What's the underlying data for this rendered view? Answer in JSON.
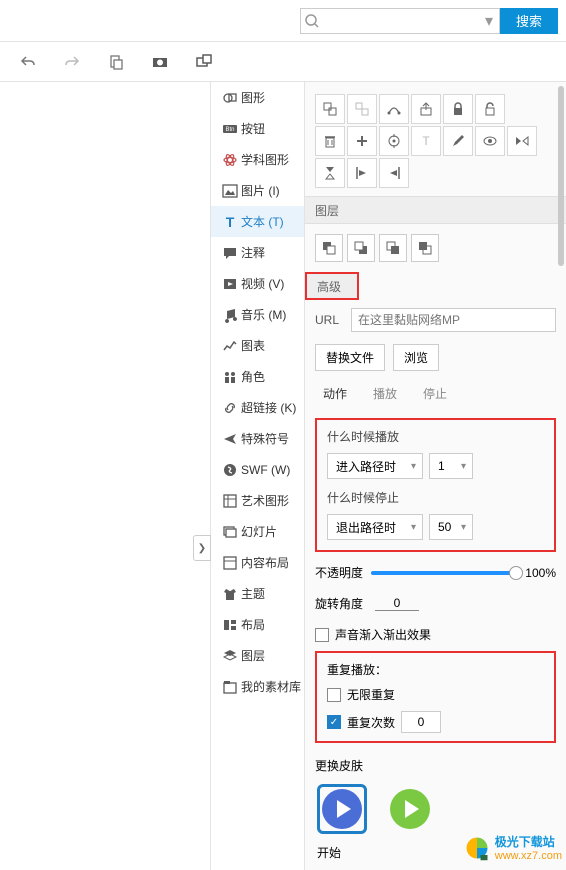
{
  "search": {
    "placeholder": "",
    "button": "搜索"
  },
  "sidebar": {
    "items": [
      {
        "label": "图形"
      },
      {
        "label": "按钮"
      },
      {
        "label": "学科图形"
      },
      {
        "label": "图片 (I)"
      },
      {
        "label": "文本 (T)"
      },
      {
        "label": "注释"
      },
      {
        "label": "视频 (V)"
      },
      {
        "label": "音乐 (M)"
      },
      {
        "label": "图表"
      },
      {
        "label": "角色"
      },
      {
        "label": "超链接 (K)"
      },
      {
        "label": "特殊符号"
      },
      {
        "label": "SWF (W)"
      },
      {
        "label": "艺术图形"
      },
      {
        "label": "幻灯片"
      },
      {
        "label": "内容布局"
      },
      {
        "label": "主题"
      },
      {
        "label": "布局"
      },
      {
        "label": "图层"
      },
      {
        "label": "我的素材库"
      }
    ]
  },
  "panel": {
    "layer_title": "图层",
    "advanced_title": "高级",
    "url_label": "URL",
    "url_placeholder": "在这里黏贴网络MP",
    "replace_file": "替换文件",
    "browse": "浏览",
    "tab_action": "动作",
    "tab_play": "播放",
    "tab_stop": "停止",
    "when_play": "什么时候播放",
    "enter_path": "进入路径时",
    "enter_val": "1",
    "when_stop": "什么时候停止",
    "exit_path": "退出路径时",
    "exit_val": "50",
    "opacity_label": "不透明度",
    "opacity_value": "100%",
    "rotate_label": "旋转角度",
    "rotate_value": "0",
    "fade_label": "声音渐入渐出效果",
    "repeat_title": "重复播放：",
    "repeat_infinite": "无限重复",
    "repeat_count_label": "重复次数",
    "repeat_count_value": "0",
    "skin_label": "更换皮肤",
    "start_label": "开始"
  },
  "watermark": {
    "brand": "极光下载站",
    "url": "www.xz7.com"
  }
}
